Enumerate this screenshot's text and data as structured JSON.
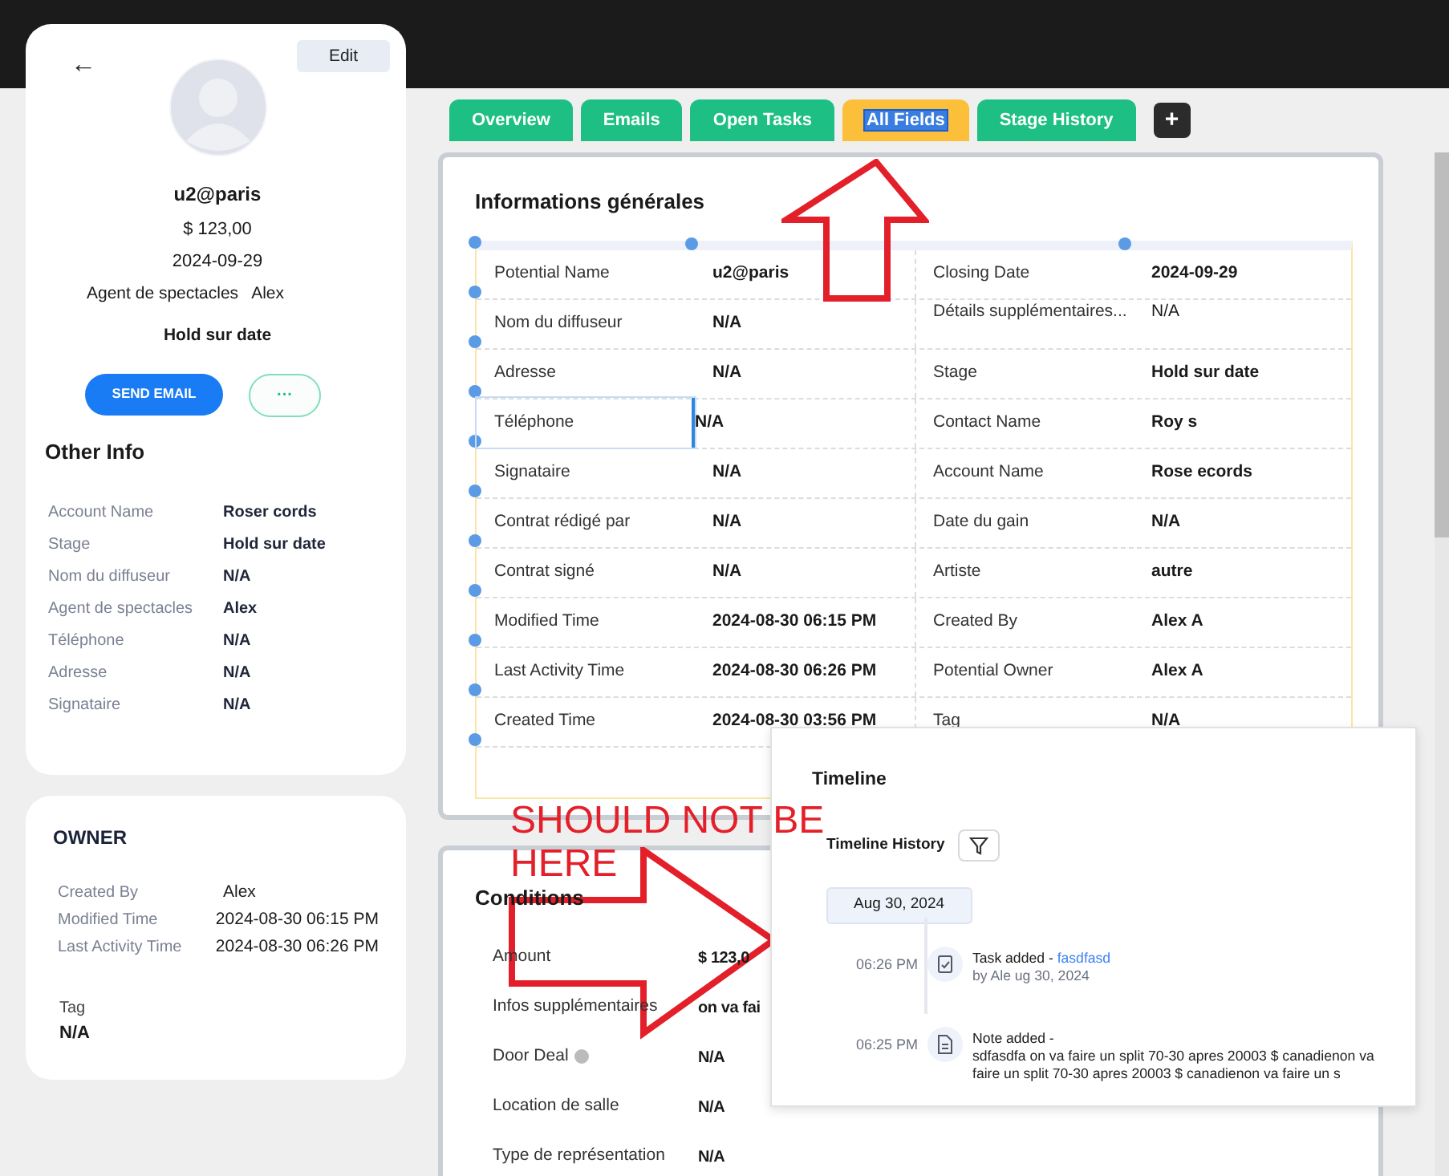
{
  "profile": {
    "back": "←",
    "edit": "Edit",
    "name": "u2@paris",
    "amount": "$ 123,00",
    "date": "2024-09-29",
    "agent_label": "Agent de spectacles",
    "agent_value": "Alex",
    "stage": "Hold sur date",
    "send_email": "SEND EMAIL",
    "more": "···"
  },
  "other_info": {
    "title": "Other Info",
    "fields": [
      {
        "label": "Account Name",
        "value": "Roser cords"
      },
      {
        "label": "Stage",
        "value": "Hold sur date"
      },
      {
        "label": "Nom du diffuseur",
        "value": "N/A"
      },
      {
        "label": "Agent de spectacles",
        "value": "Alex"
      },
      {
        "label": "Téléphone",
        "value": "N/A"
      },
      {
        "label": "Adresse",
        "value": "N/A"
      },
      {
        "label": "Signataire",
        "value": "N/A"
      }
    ]
  },
  "owner": {
    "title": "OWNER",
    "fields": [
      {
        "label": "Created By",
        "value": "Alex"
      },
      {
        "label": "Modified Time",
        "value": "2024-08-30 06:15 PM"
      },
      {
        "label": "Last Activity Time",
        "value": "2024-08-30 06:26 PM"
      }
    ],
    "tag": {
      "label": "Tag",
      "value": "N/A"
    }
  },
  "tabs": [
    {
      "label": "Overview",
      "selected": false
    },
    {
      "label": "Emails",
      "selected": false
    },
    {
      "label": "Open Tasks",
      "selected": false
    },
    {
      "label": "All Fields",
      "selected": true
    },
    {
      "label": "Stage History",
      "selected": false
    }
  ],
  "add_tab": "+",
  "general": {
    "title": "Informations générales",
    "rows": [
      {
        "cells": [
          {
            "label": "Potential Name",
            "value": "u2@paris",
            "selected": false
          },
          {
            "label": "Closing Date",
            "value": "2024-09-29",
            "selected": false
          }
        ]
      },
      {
        "cells": [
          {
            "label": "Nom du diffuseur",
            "value": "N/A",
            "selected": false
          },
          {
            "label": "Détails supplémentaires...",
            "value": "N/A",
            "selected": false,
            "kind": "multiline"
          }
        ]
      },
      {
        "cells": [
          {
            "label": "Adresse",
            "value": "N/A",
            "selected": false
          },
          {
            "label": "Stage",
            "value": "Hold sur date",
            "selected": false
          }
        ]
      },
      {
        "cells": [
          {
            "label": "Téléphone",
            "value": "N/A",
            "selected": true
          },
          {
            "label": "Contact Name",
            "value": "Roy s",
            "selected": false
          }
        ]
      },
      {
        "cells": [
          {
            "label": "Signataire",
            "value": "N/A",
            "selected": false
          },
          {
            "label": "Account Name",
            "value": "Rose ecords",
            "selected": false
          }
        ]
      },
      {
        "cells": [
          {
            "label": "Contrat rédigé par",
            "value": "N/A",
            "selected": false
          },
          {
            "label": "Date du gain",
            "value": "N/A",
            "selected": false
          }
        ]
      },
      {
        "cells": [
          {
            "label": "Contrat signé",
            "value": "N/A",
            "selected": false
          },
          {
            "label": "Artiste",
            "value": "autre",
            "selected": false
          }
        ]
      },
      {
        "cells": [
          {
            "label": "Modified Time",
            "value": "2024-08-30 06:15 PM",
            "selected": false
          },
          {
            "label": "Created By",
            "value": "Alex A",
            "selected": false
          }
        ]
      },
      {
        "cells": [
          {
            "label": "Last Activity Time",
            "value": "2024-08-30 06:26 PM",
            "selected": false
          },
          {
            "label": "Potential Owner",
            "value": "Alex A",
            "selected": false
          }
        ]
      },
      {
        "cells": [
          {
            "label": "Created Time",
            "value": "2024-08-30 03:56 PM",
            "selected": false
          },
          {
            "label": "Tag",
            "value": "N/A",
            "selected": false
          }
        ]
      }
    ]
  },
  "conditions": {
    "title": "Conditions",
    "fields": [
      {
        "label": "Amount",
        "value": "$ 123,0"
      },
      {
        "label": "Infos supplémentaires",
        "value": "on va fai"
      },
      {
        "label": "Door Deal",
        "value": "N/A",
        "info": true
      },
      {
        "label": "Location de salle",
        "value": "N/A"
      },
      {
        "label": "Type de représentation",
        "value": "N/A"
      }
    ]
  },
  "timeline": {
    "title": "Timeline",
    "history": "Timeline History",
    "date": "Aug 30, 2024",
    "items": [
      {
        "kind": "task",
        "time": "06:26 PM",
        "title": "Task added - ",
        "link": "fasdfasd",
        "detail": "by Ale ug 30, 2024"
      },
      {
        "kind": "note",
        "time": "06:25 PM",
        "title": "Note added -",
        "detail": "sdfasdfa on va faire un split 70-30 apres 20003 $ canadienon va faire un split 70-30 apres 20003 $ canadienon va faire un s"
      }
    ]
  },
  "annotations": [
    {
      "kind": "arrow-up"
    },
    {
      "kind": "text",
      "lines": [
        "SHOULD NOT BE",
        "HERE"
      ]
    },
    {
      "kind": "arrow-right"
    }
  ]
}
